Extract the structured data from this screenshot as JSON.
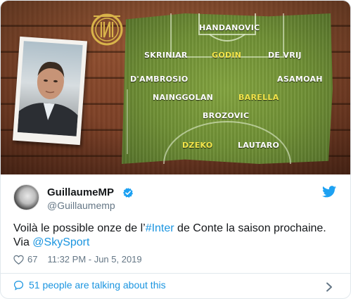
{
  "media": {
    "players": [
      {
        "name": "HANDANOVIC",
        "highlight": false
      },
      {
        "name": "SKRINIAR",
        "highlight": false
      },
      {
        "name": "GODIN",
        "highlight": true
      },
      {
        "name": "DE VRIJ",
        "highlight": false
      },
      {
        "name": "D'AMBROSIO",
        "highlight": false
      },
      {
        "name": "ASAMOAH",
        "highlight": false
      },
      {
        "name": "NAINGGOLAN",
        "highlight": false
      },
      {
        "name": "BARELLA",
        "highlight": true
      },
      {
        "name": "BROZOVIC",
        "highlight": false
      },
      {
        "name": "DZEKO",
        "highlight": true
      },
      {
        "name": "LAUTARO",
        "highlight": false
      }
    ],
    "colors": {
      "highlight": "#f4e64a",
      "pitch": "#6f8f35",
      "wood": "#8a4a2c"
    }
  },
  "author": {
    "display_name": "GuillaumeMP",
    "handle": "@Guillaumemp",
    "verified": true
  },
  "tweet": {
    "text_before": "Voilà le possible onze de l’",
    "hashtag": "#Inter",
    "text_middle": " de Conte la saison prochaine. Via ",
    "mention": "@SkySport"
  },
  "meta": {
    "likes": "67",
    "timestamp": "11:32 PM - Jun 5, 2019"
  },
  "footer": {
    "talking_label": "51 people are talking about this"
  },
  "icons": [
    "twitter-bird-icon",
    "verified-badge-icon",
    "heart-icon",
    "speech-bubble-icon",
    "chevron-right-icon",
    "inter-logo"
  ],
  "colors": {
    "link": "#1b95e0",
    "text": "#14171a",
    "muted": "#657786",
    "border": "#e1e8ed"
  }
}
